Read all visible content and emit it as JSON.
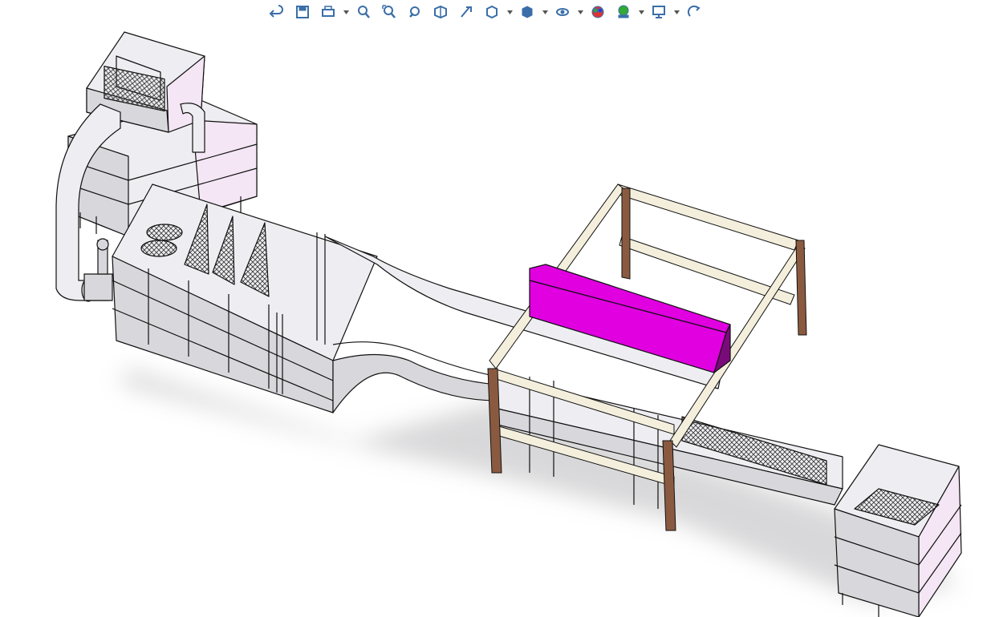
{
  "toolbar": {
    "items": [
      {
        "icon": "undo-icon",
        "dropdown": false
      },
      {
        "icon": "save-icon",
        "dropdown": false
      },
      {
        "icon": "print-icon",
        "dropdown": true
      },
      {
        "icon": "zoom-to-fit-icon",
        "dropdown": false
      },
      {
        "icon": "zoom-to-area-icon",
        "dropdown": false
      },
      {
        "icon": "previous-view-icon",
        "dropdown": false
      },
      {
        "icon": "section-view-icon",
        "dropdown": false
      },
      {
        "icon": "dynamic-annotation-icon",
        "dropdown": false
      },
      {
        "icon": "view-orientation-icon",
        "dropdown": true
      },
      {
        "icon": "display-style-icon",
        "dropdown": true
      },
      {
        "icon": "hide-show-items-icon",
        "dropdown": true
      },
      {
        "icon": "edit-appearance-icon",
        "dropdown": false
      },
      {
        "icon": "apply-scene-icon",
        "dropdown": true
      },
      {
        "icon": "view-settings-icon",
        "dropdown": true
      },
      {
        "icon": "rotate-view-icon",
        "dropdown": false
      }
    ]
  },
  "colors": {
    "toolbar_icon": "#3a6ea8",
    "panel": "#eeeef2",
    "panel_shade": "#d8d8dc",
    "panel_pink": "#f4e6f4",
    "frame_wood": "#8a5a40",
    "frame_cream": "#f4efdc",
    "highlight_box": "#e000e0",
    "highlight_box_dark": "#7a0a7a",
    "edge": "#111111",
    "shadow": "#b9b9bc"
  }
}
